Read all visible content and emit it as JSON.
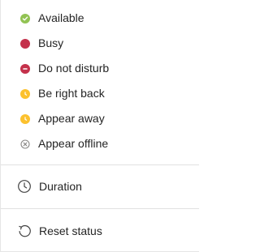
{
  "statuses": [
    {
      "label": "Available",
      "icon": "available-check-icon",
      "color": "#92c353"
    },
    {
      "label": "Busy",
      "icon": "busy-dot-icon",
      "color": "#c4314b"
    },
    {
      "label": "Do not disturb",
      "icon": "dnd-minus-icon",
      "color": "#c4314b"
    },
    {
      "label": "Be right back",
      "icon": "be-right-back-clock-icon",
      "color": "#fcc12e"
    },
    {
      "label": "Appear away",
      "icon": "away-clock-icon",
      "color": "#fcc12e"
    },
    {
      "label": "Appear offline",
      "icon": "offline-x-icon",
      "color": "#8a8886"
    }
  ],
  "actions": {
    "duration": {
      "label": "Duration",
      "icon": "clock-icon"
    },
    "reset": {
      "label": "Reset status",
      "icon": "reset-icon"
    }
  }
}
